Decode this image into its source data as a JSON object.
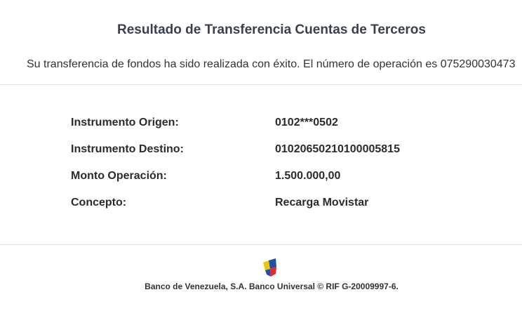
{
  "header": {
    "title": "Resultado de Transferencia Cuentas de Terceros",
    "message": "Su transferencia de fondos ha sido realizada con éxito. El número de operación es 075290030473"
  },
  "details": [
    {
      "label": "Instrumento Origen:",
      "value": "0102***0502"
    },
    {
      "label": "Instrumento Destino:",
      "value": "01020650210100005815"
    },
    {
      "label": "Monto Operación:",
      "value": "1.500.000,00"
    },
    {
      "label": "Concepto:",
      "value": "Recarga Movistar"
    }
  ],
  "footer": {
    "logo_icon": "banco-de-venezuela-logo-icon",
    "legal_text": "Banco de Venezuela, S.A. Banco Universal © RIF G-20009997-6."
  }
}
